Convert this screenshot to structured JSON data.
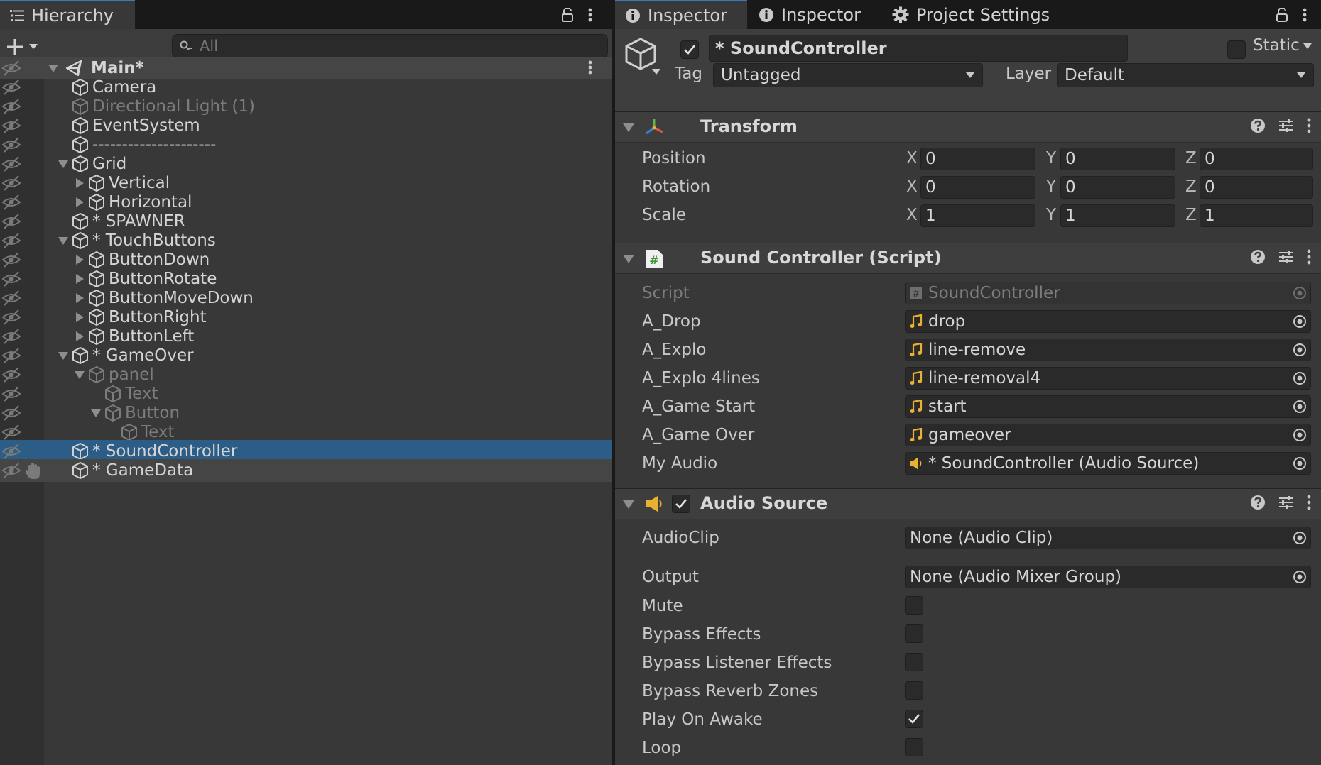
{
  "hierarchy": {
    "tab_label": "Hierarchy",
    "search": {
      "placeholder": "All"
    },
    "scene": {
      "name": "Main*"
    },
    "items": [
      {
        "label": "Camera",
        "depth": 0,
        "arrow": "none",
        "dim": false,
        "selected": false
      },
      {
        "label": "Directional Light (1)",
        "depth": 0,
        "arrow": "none",
        "dim": true,
        "selected": false
      },
      {
        "label": "EventSystem",
        "depth": 0,
        "arrow": "none",
        "dim": false,
        "selected": false
      },
      {
        "label": "---------------------",
        "depth": 0,
        "arrow": "none",
        "dim": false,
        "selected": false
      },
      {
        "label": "Grid",
        "depth": 0,
        "arrow": "down",
        "dim": false,
        "selected": false
      },
      {
        "label": "Vertical",
        "depth": 1,
        "arrow": "right",
        "dim": false,
        "selected": false
      },
      {
        "label": "Horizontal",
        "depth": 1,
        "arrow": "right",
        "dim": false,
        "selected": false
      },
      {
        "label": "* SPAWNER",
        "depth": 0,
        "arrow": "none",
        "dim": false,
        "selected": false
      },
      {
        "label": "* TouchButtons",
        "depth": 0,
        "arrow": "down",
        "dim": false,
        "selected": false
      },
      {
        "label": "ButtonDown",
        "depth": 1,
        "arrow": "right",
        "dim": false,
        "selected": false
      },
      {
        "label": "ButtonRotate",
        "depth": 1,
        "arrow": "right",
        "dim": false,
        "selected": false
      },
      {
        "label": "ButtonMoveDown",
        "depth": 1,
        "arrow": "right",
        "dim": false,
        "selected": false
      },
      {
        "label": "ButtonRight",
        "depth": 1,
        "arrow": "right",
        "dim": false,
        "selected": false
      },
      {
        "label": "ButtonLeft",
        "depth": 1,
        "arrow": "right",
        "dim": false,
        "selected": false
      },
      {
        "label": "* GameOver",
        "depth": 0,
        "arrow": "down",
        "dim": false,
        "selected": false
      },
      {
        "label": "panel",
        "depth": 1,
        "arrow": "down",
        "dim": true,
        "selected": false
      },
      {
        "label": "Text",
        "depth": 2,
        "arrow": "none",
        "dim": true,
        "selected": false
      },
      {
        "label": "Button",
        "depth": 2,
        "arrow": "down",
        "dim": true,
        "selected": false
      },
      {
        "label": "Text",
        "depth": 3,
        "arrow": "none",
        "dim": true,
        "selected": false
      },
      {
        "label": "* SoundController",
        "depth": 0,
        "arrow": "none",
        "dim": false,
        "selected": true
      },
      {
        "label": "* GameData",
        "depth": 0,
        "arrow": "none",
        "dim": false,
        "selected": false,
        "hover": true
      }
    ]
  },
  "inspector": {
    "tabs": [
      {
        "label": "Inspector",
        "icon": "info-icon",
        "active": true
      },
      {
        "label": "Inspector",
        "icon": "info-icon",
        "active": false
      },
      {
        "label": "Project Settings",
        "icon": "gear-icon",
        "active": false
      }
    ],
    "object": {
      "active": true,
      "name": "* SoundController",
      "static_label": "Static",
      "tag_label": "Tag",
      "tag_value": "Untagged",
      "layer_label": "Layer",
      "layer_value": "Default"
    },
    "transform": {
      "title": "Transform",
      "rows": [
        {
          "label": "Position",
          "x": "0",
          "y": "0",
          "z": "0"
        },
        {
          "label": "Rotation",
          "x": "0",
          "y": "0",
          "z": "0"
        },
        {
          "label": "Scale",
          "x": "1",
          "y": "1",
          "z": "1"
        }
      ],
      "axis_x": "X",
      "axis_y": "Y",
      "axis_z": "Z"
    },
    "script_component": {
      "title": "Sound Controller (Script)",
      "rows": [
        {
          "label": "Script",
          "value": "SoundController",
          "icon": "script-icon",
          "dim": true
        },
        {
          "label": "A_Drop",
          "value": "drop",
          "icon": "audio-clip-icon",
          "dim": false
        },
        {
          "label": "A_Explo",
          "value": "line-remove",
          "icon": "audio-clip-icon",
          "dim": false
        },
        {
          "label": "A_Explo 4lines",
          "value": "line-removal4",
          "icon": "audio-clip-icon",
          "dim": false
        },
        {
          "label": "A_Game Start",
          "value": "start",
          "icon": "audio-clip-icon",
          "dim": false
        },
        {
          "label": "A_Game Over",
          "value": "gameover",
          "icon": "audio-clip-icon",
          "dim": false
        },
        {
          "label": "My Audio",
          "value": "* SoundController (Audio Source)",
          "icon": "audio-source-icon",
          "dim": false
        }
      ]
    },
    "audio_source": {
      "title": "Audio Source",
      "enabled": true,
      "audio_clip_label": "AudioClip",
      "audio_clip_value": "None (Audio Clip)",
      "output_label": "Output",
      "output_value": "None (Audio Mixer Group)",
      "toggles": [
        {
          "label": "Mute",
          "checked": false
        },
        {
          "label": "Bypass Effects",
          "checked": false
        },
        {
          "label": "Bypass Listener Effects",
          "checked": false
        },
        {
          "label": "Bypass Reverb Zones",
          "checked": false
        },
        {
          "label": "Play On Awake",
          "checked": true
        },
        {
          "label": "Loop",
          "checked": false
        }
      ]
    }
  },
  "colors": {
    "selection": "#2c5d87",
    "tab_accent": "#3a79bb",
    "audio_icon": "#e8b230",
    "script_icon": "#5fb45f"
  }
}
